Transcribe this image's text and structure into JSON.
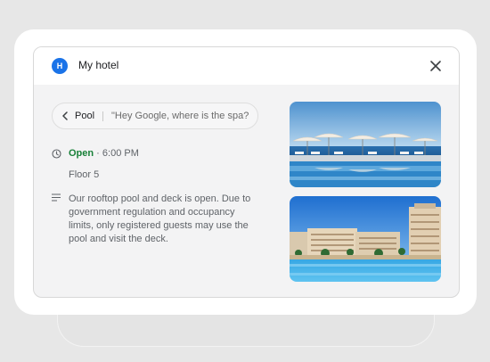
{
  "card": {
    "avatar_letter": "H",
    "title": "My hotel",
    "close_icon": "close-icon"
  },
  "chip": {
    "back_icon": "chevron-left-icon",
    "label": "Pool",
    "hint": "\"Hey Google, where is the spa?"
  },
  "info": {
    "hours_icon": "clock-icon",
    "status": "Open",
    "hours": " · 6:00 PM",
    "floor": "Floor 5",
    "description_icon": "notes-icon",
    "description": "Our rooftop pool and deck is open. Due to government regulation and occupancy limits, only registered guests may use the pool and visit the deck."
  },
  "colors": {
    "accent": "#1a73e8",
    "open_green": "#188038"
  }
}
